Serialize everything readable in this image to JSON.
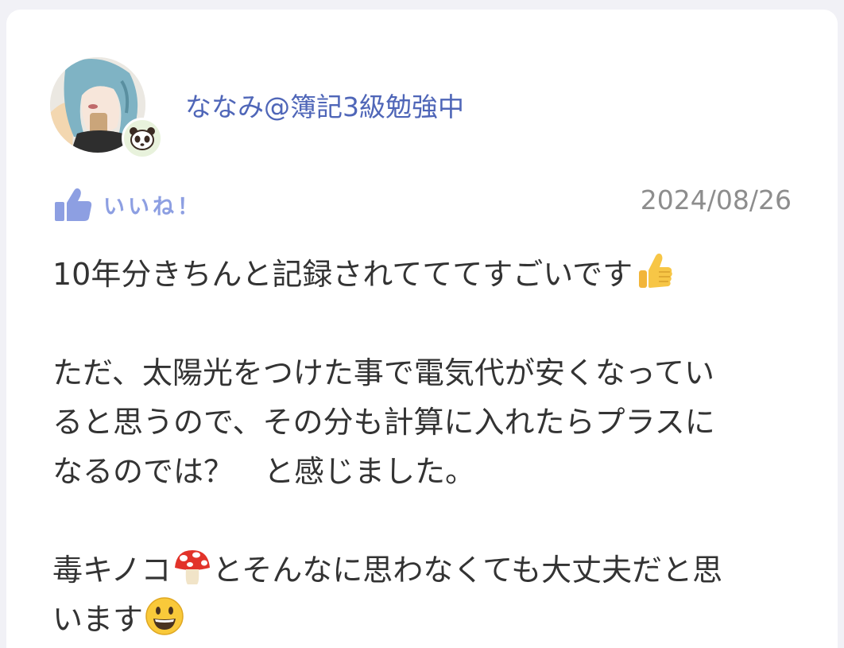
{
  "post": {
    "username": "ななみ@簿記3級勉強中",
    "like_label": "いいね！",
    "date": "2024/08/26",
    "body": {
      "line1": "10年分きちんと記録されてててすごいです",
      "line2": "ただ、太陽光をつけた事で電気代が安くなってい",
      "line3": "ると思うので、その分も計算に入れたらプラスに",
      "line4": "なるのでは？　と感じました。",
      "line5a": "毒キノコ",
      "line5b": "とそんなに思わなくても大丈夫だと思",
      "line6": "います"
    }
  },
  "icons": {
    "avatar": "user-avatar-illustration",
    "badge": "panda-icon",
    "like": "thumbs-up-icon",
    "emoji1": "thumbs-up-emoji",
    "emoji2": "mushroom-emoji",
    "emoji3": "smiling-face-emoji"
  },
  "colors": {
    "accent": "#4f66b8",
    "like": "#8d9fe2",
    "date": "#8d8d8d",
    "text": "#333333"
  }
}
